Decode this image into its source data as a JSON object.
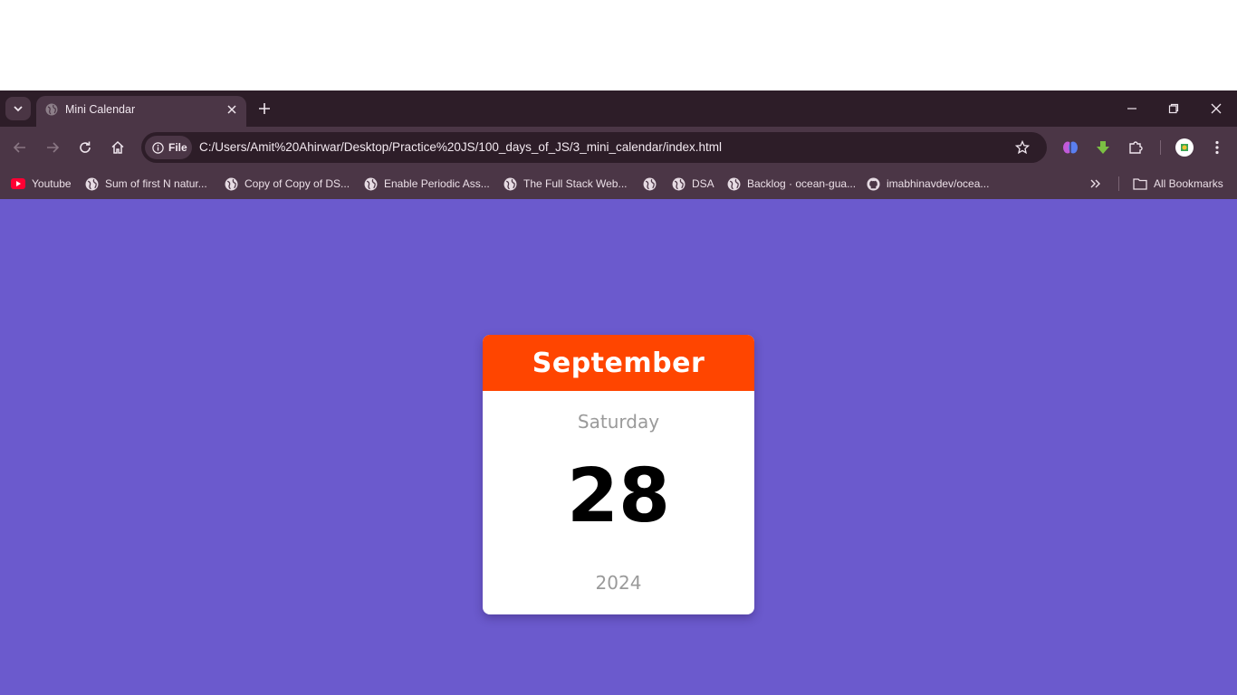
{
  "browser": {
    "tab": {
      "title": "Mini Calendar"
    },
    "address": {
      "chip_label": "File",
      "url": "C:/Users/Amit%20Ahirwar/Desktop/Practice%20JS/100_days_of_JS/3_mini_calendar/index.html"
    },
    "bookmarks": [
      {
        "label": "Youtube",
        "icon": "youtube-icon"
      },
      {
        "label": "Sum of first N natur...",
        "icon": "globe-icon"
      },
      {
        "label": "Copy of Copy of DS...",
        "icon": "globe-icon"
      },
      {
        "label": "Enable Periodic Ass...",
        "icon": "globe-icon"
      },
      {
        "label": "The Full Stack Web...",
        "icon": "globe-icon"
      },
      {
        "label": "",
        "icon": "globe-icon"
      },
      {
        "label": "DSA",
        "icon": "globe-icon"
      },
      {
        "label": "Backlog · ocean-gua...",
        "icon": "globe-icon"
      },
      {
        "label": "imabhinavdev/ocea...",
        "icon": "github-icon"
      }
    ],
    "all_bookmarks_label": "All Bookmarks",
    "colors": {
      "tabstrip": "#2d1d28",
      "toolbar": "#4b3646"
    }
  },
  "page": {
    "background": "#6b5acd",
    "calendar": {
      "month": "September",
      "weekday": "Saturday",
      "day": "28",
      "year": "2024",
      "header_color": "#ff4500"
    }
  }
}
